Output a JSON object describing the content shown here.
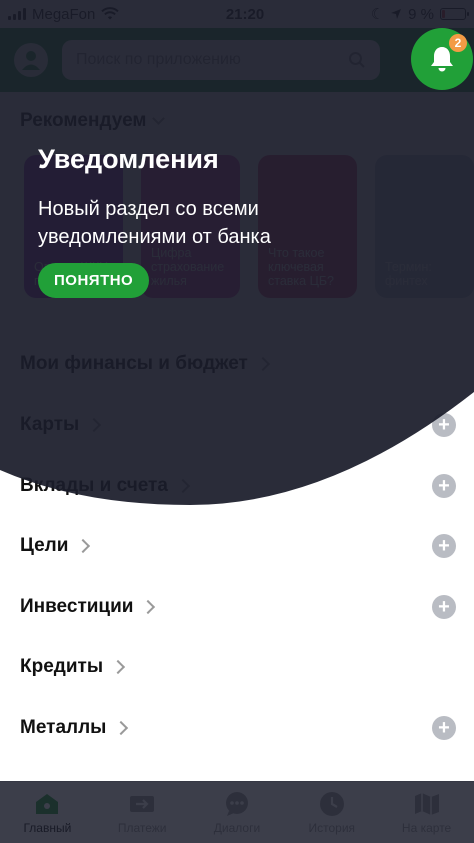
{
  "status_bar": {
    "carrier": "MegaFon",
    "time": "21:20",
    "battery_pct": "9 %"
  },
  "search": {
    "placeholder": "Поиск по приложению"
  },
  "recommended": {
    "title": "Рекомендуем",
    "cards": [
      {
        "text": "Оплата ЖКУ по счётчикам"
      },
      {
        "text": "Цифра страхование жилья"
      },
      {
        "text": "Что такое ключевая ставка ЦБ?"
      },
      {
        "text": "Термин: финтех"
      }
    ]
  },
  "sections": [
    {
      "label": "Мои финансы и бюджет",
      "has_plus": false
    },
    {
      "label": "Карты",
      "has_plus": true
    },
    {
      "label": "Вклады и счета",
      "has_plus": true
    },
    {
      "label": "Цели",
      "has_plus": true
    },
    {
      "label": "Инвестиции",
      "has_plus": true
    },
    {
      "label": "Кредиты",
      "has_plus": false
    },
    {
      "label": "Металлы",
      "has_plus": true
    }
  ],
  "onboarding": {
    "title": "Уведомления",
    "text": "Новый раздел со всеми уведомлениями от банка",
    "button": "ПОНЯТНО"
  },
  "notifications": {
    "count": "2"
  },
  "tabbar": {
    "items": [
      {
        "label": "Главный",
        "icon": "home-icon",
        "active": true
      },
      {
        "label": "Платежи",
        "icon": "transfer-icon",
        "active": false
      },
      {
        "label": "Диалоги",
        "icon": "chat-icon",
        "active": false
      },
      {
        "label": "История",
        "icon": "clock-icon",
        "active": false
      },
      {
        "label": "На карте",
        "icon": "map-icon",
        "active": false
      }
    ]
  },
  "colors": {
    "brand_green": "#21a038",
    "overlay": "#1a1c2a",
    "badge": "#f39b45"
  }
}
